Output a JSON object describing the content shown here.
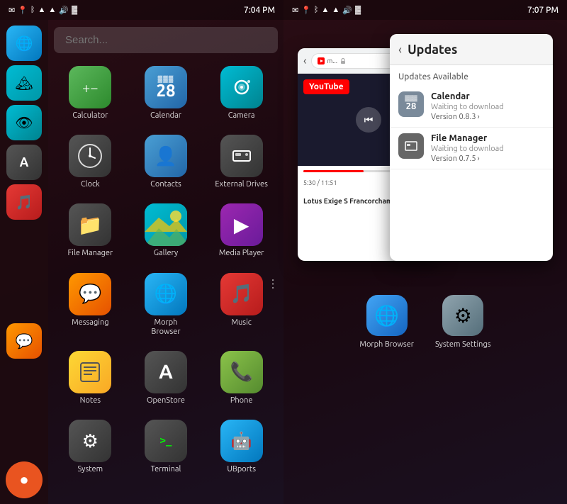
{
  "leftPhone": {
    "statusBar": {
      "time": "7:04 PM",
      "icons": [
        "✉",
        "📍",
        "ᛒ",
        "📶",
        "📶",
        "🔊",
        "🔋"
      ]
    },
    "searchPlaceholder": "Search...",
    "apps": [
      {
        "id": "calculator",
        "label": "Calculator",
        "icon": "±",
        "bg": "bg-green",
        "symbol": "+-"
      },
      {
        "id": "calendar",
        "label": "Calendar",
        "icon": "28",
        "bg": "bg-blue"
      },
      {
        "id": "camera",
        "label": "Camera",
        "icon": "👁",
        "bg": "bg-cyan"
      },
      {
        "id": "clock",
        "label": "Clock",
        "icon": "🕐",
        "bg": "bg-dark"
      },
      {
        "id": "contacts",
        "label": "Contacts",
        "icon": "👤",
        "bg": "bg-blue"
      },
      {
        "id": "external-drives",
        "label": "External Drives",
        "icon": "💾",
        "bg": "bg-dark"
      },
      {
        "id": "file-manager",
        "label": "File Manager",
        "icon": "📁",
        "bg": "bg-dark"
      },
      {
        "id": "gallery",
        "label": "Gallery",
        "icon": "🏔",
        "bg": "bg-teal"
      },
      {
        "id": "media-player",
        "label": "Media Player",
        "icon": "▶",
        "bg": "bg-purple"
      },
      {
        "id": "messaging",
        "label": "Messaging",
        "icon": "💬",
        "bg": "bg-orange"
      },
      {
        "id": "morph-browser",
        "label": "Morph Browser",
        "icon": "🌐",
        "bg": "bg-lightblue"
      },
      {
        "id": "music",
        "label": "Music",
        "icon": "🎵",
        "bg": "bg-red"
      },
      {
        "id": "notes",
        "label": "Notes",
        "icon": "📝",
        "bg": "bg-yellow"
      },
      {
        "id": "openstore",
        "label": "OpenStore",
        "icon": "A",
        "bg": "bg-dark"
      },
      {
        "id": "phone",
        "label": "Phone",
        "icon": "📞",
        "bg": "bg-lime"
      },
      {
        "id": "system",
        "label": "System",
        "icon": "⚙",
        "bg": "bg-dark"
      },
      {
        "id": "terminal",
        "label": "Terminal",
        "icon": ">_",
        "bg": "bg-dark"
      },
      {
        "id": "ubports",
        "label": "UBports",
        "icon": "🤖",
        "bg": "bg-lightblue"
      }
    ],
    "sidebar": {
      "items": [
        {
          "id": "sidebar-app1",
          "icon": "🌐",
          "bg": "bg-lightblue"
        },
        {
          "id": "sidebar-app2",
          "icon": "🏔",
          "bg": "bg-teal"
        },
        {
          "id": "sidebar-app3",
          "icon": "👁",
          "bg": "bg-cyan"
        },
        {
          "id": "sidebar-app4",
          "icon": "A",
          "bg": "bg-dark"
        },
        {
          "id": "sidebar-app5",
          "icon": "📱",
          "bg": "bg-red"
        }
      ],
      "bottomIcon": "💬",
      "ubuntuBtn": "●"
    }
  },
  "rightPhone": {
    "statusBar": {
      "time": "7:07 PM"
    },
    "youtube": {
      "addressBar": "m...",
      "youtubeLabel": "YouTube",
      "videoTitle": "Lotus Exige S\nFrancorcham...",
      "timeProgress": "5:30 / 11:51",
      "progressPct": 46
    },
    "updates": {
      "title": "Updates",
      "backLabel": "‹",
      "availableLabel": "Updates Available",
      "items": [
        {
          "id": "calendar-update",
          "name": "Calendar",
          "iconLabel": "28",
          "status": "Waiting to download",
          "version": "Version 0.8.3"
        },
        {
          "id": "filemanager-update",
          "name": "File Manager",
          "iconLabel": "■",
          "status": "Waiting to download",
          "version": "Version 0.7.5"
        }
      ]
    },
    "dock": [
      {
        "id": "morph-browser-dock",
        "label": "Morph Browser",
        "icon": "🌐",
        "bg": "bg-morph"
      },
      {
        "id": "system-settings-dock",
        "label": "System Settings",
        "icon": "⚙",
        "bg": "bg-settings"
      }
    ]
  }
}
